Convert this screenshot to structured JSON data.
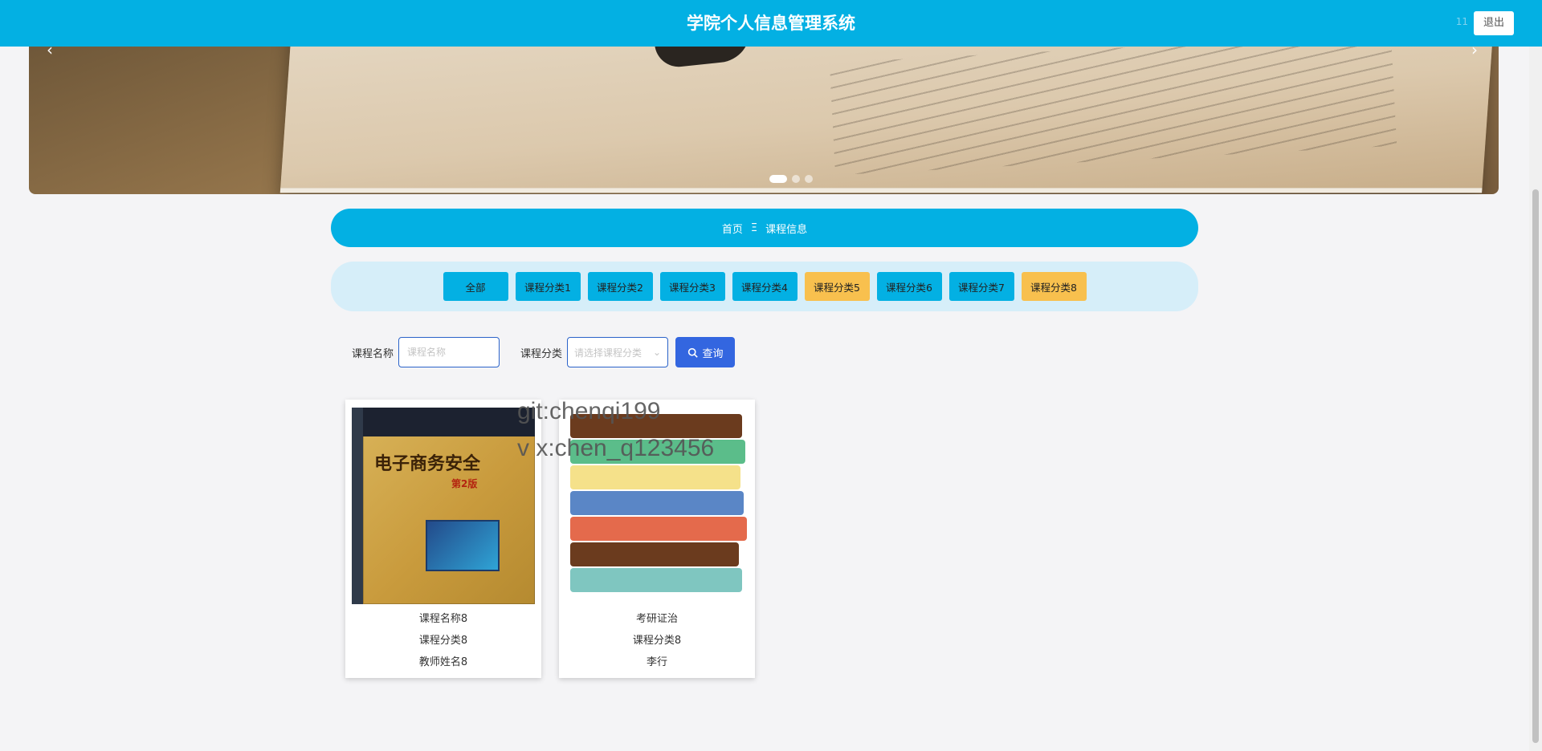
{
  "header": {
    "title": "学院个人信息管理系统",
    "user": "11",
    "logout_label": "退出"
  },
  "banner": {
    "prev_icon": "‹",
    "next_icon": "›",
    "slide_count": 3,
    "active_slide": 1
  },
  "breadcrumb": {
    "home": "首页",
    "separator": "Ξ",
    "current": "课程信息"
  },
  "categories": [
    {
      "label": "全部",
      "color": "#03b0e3"
    },
    {
      "label": "课程分类1",
      "color": "#03b0e3"
    },
    {
      "label": "课程分类2",
      "color": "#03b0e3"
    },
    {
      "label": "课程分类3",
      "color": "#03b0e3"
    },
    {
      "label": "课程分类4",
      "color": "#03b0e3"
    },
    {
      "label": "课程分类5",
      "color": "#f8c04e"
    },
    {
      "label": "课程分类6",
      "color": "#03b0e3"
    },
    {
      "label": "课程分类7",
      "color": "#03b0e3"
    },
    {
      "label": "课程分类8",
      "color": "#f8c04e"
    }
  ],
  "search": {
    "name_label": "课程名称",
    "name_placeholder": "课程名称",
    "category_label": "课程分类",
    "category_placeholder": "请选择课程分类",
    "query_label": "查询"
  },
  "watermark": {
    "line1": "git:chenqi199",
    "line2": "v x:chen_q123456"
  },
  "courses": [
    {
      "name": "课程名称8",
      "category": "课程分类8",
      "teacher": "教师姓名8",
      "cover": {
        "title": "电子商务安全",
        "edition": "第2版"
      }
    },
    {
      "name": "考研证治",
      "category": "课程分类8",
      "teacher": "李行"
    }
  ]
}
